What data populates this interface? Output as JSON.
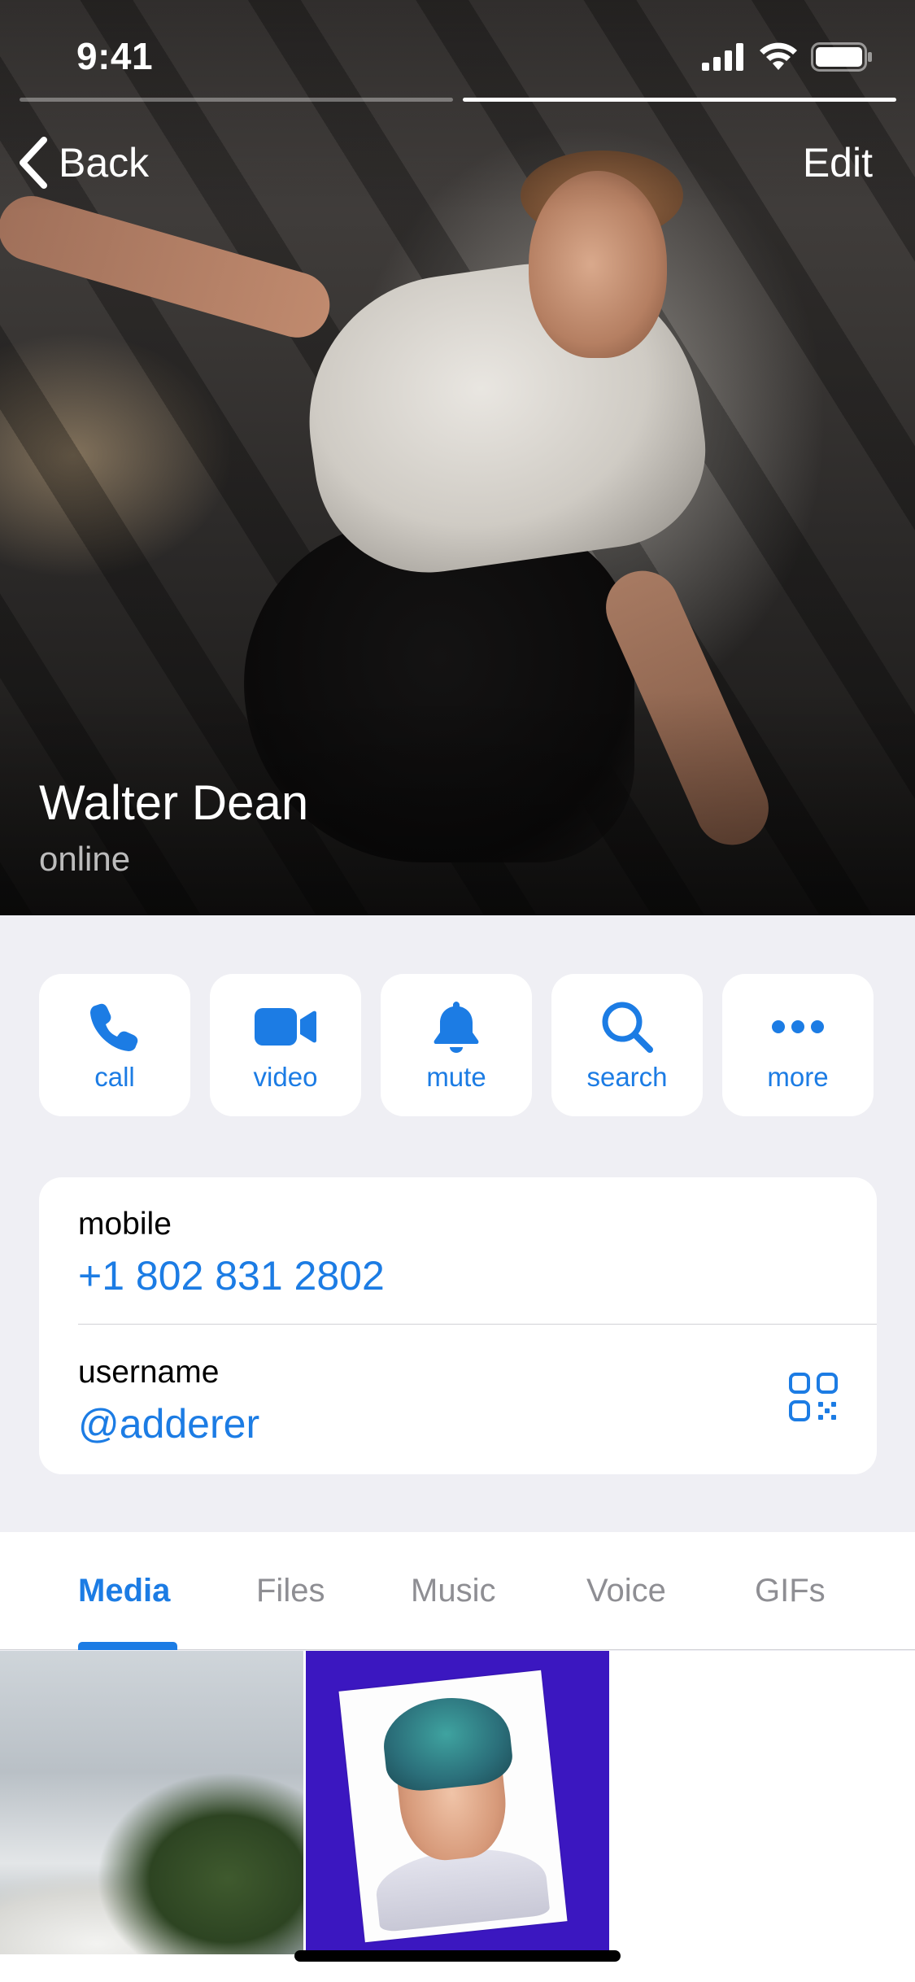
{
  "status_bar": {
    "time": "9:41",
    "icons": [
      "cellular-signal-icon",
      "wifi-icon",
      "battery-icon"
    ]
  },
  "story": {
    "segments": 2,
    "active_segment": 2
  },
  "nav": {
    "back_label": "Back",
    "edit_label": "Edit"
  },
  "profile": {
    "name": "Walter Dean",
    "status": "online"
  },
  "actions": [
    {
      "label": "call",
      "icon": "phone-icon"
    },
    {
      "label": "video",
      "icon": "video-camera-icon"
    },
    {
      "label": "mute",
      "icon": "bell-icon"
    },
    {
      "label": "search",
      "icon": "search-icon"
    },
    {
      "label": "more",
      "icon": "ellipsis-icon"
    }
  ],
  "info": {
    "mobile_label": "mobile",
    "mobile_value": "+1 802 831 2802",
    "username_label": "username",
    "username_value": "@adderer",
    "qr_icon": "qr-code-icon"
  },
  "tabs": [
    {
      "label": "Media",
      "active": true
    },
    {
      "label": "Files",
      "active": false
    },
    {
      "label": "Music",
      "active": false
    },
    {
      "label": "Voice",
      "active": false
    },
    {
      "label": "GIFs",
      "active": false
    }
  ],
  "colors": {
    "accent": "#1C7CE4",
    "background": "#EFEFF4",
    "card": "#FFFFFF",
    "inactive_tab": "#8E8E93"
  }
}
